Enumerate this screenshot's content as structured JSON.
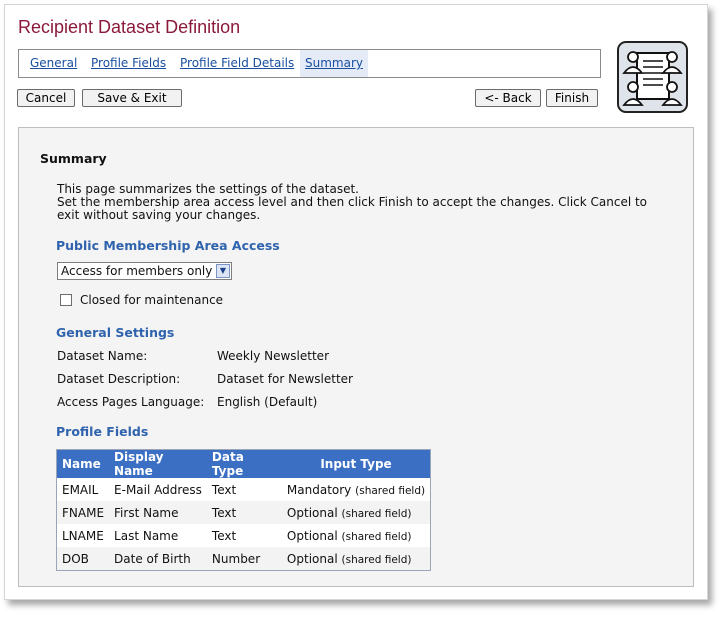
{
  "header": {
    "title": "Recipient Dataset Definition",
    "tabs": [
      {
        "label": "General"
      },
      {
        "label": "Profile Fields"
      },
      {
        "label": "Profile Field Details"
      },
      {
        "label": "Summary"
      }
    ],
    "active_tab": "Summary",
    "logo_icon": "people-profile-icon"
  },
  "toolbar": {
    "cancel_label": "Cancel",
    "save_exit_label": "Save & Exit",
    "back_label": "<- Back",
    "finish_label": "Finish"
  },
  "summary": {
    "heading": "Summary",
    "intro_line1": "This page summarizes the settings of the dataset.",
    "intro_line2": "Set the membership area access level and then click Finish to accept the changes. Click Cancel to",
    "intro_line3": "exit without saving your changes."
  },
  "access": {
    "heading": "Public Membership Area Access",
    "selected": "Access for members only",
    "maintenance_label": "Closed for maintenance",
    "maintenance_checked": false
  },
  "general": {
    "heading": "General Settings",
    "name_label": "Dataset Name:",
    "name_value": "Weekly Newsletter",
    "desc_label": "Dataset Description:",
    "desc_value": "Dataset for Newsletter",
    "lang_label": "Access Pages Language:",
    "lang_value": "English (Default)"
  },
  "profile_fields": {
    "heading": "Profile Fields",
    "columns": [
      "Name",
      "Display Name",
      "Data Type",
      "Input Type"
    ],
    "rows": [
      {
        "name": "EMAIL",
        "display": "E-Mail Address",
        "type": "Text",
        "input": "Mandatory",
        "note": "(shared field)"
      },
      {
        "name": "FNAME",
        "display": "First Name",
        "type": "Text",
        "input": "Optional",
        "note": "(shared field)"
      },
      {
        "name": "LNAME",
        "display": "Last Name",
        "type": "Text",
        "input": "Optional",
        "note": "(shared field)"
      },
      {
        "name": "DOB",
        "display": "Date of Birth",
        "type": "Number",
        "input": "Optional",
        "note": "(shared field)"
      }
    ]
  },
  "colors": {
    "title": "#8b1a3a",
    "link": "#1a4fa0",
    "section": "#2f63ad",
    "table_header": "#3b6fc4"
  }
}
